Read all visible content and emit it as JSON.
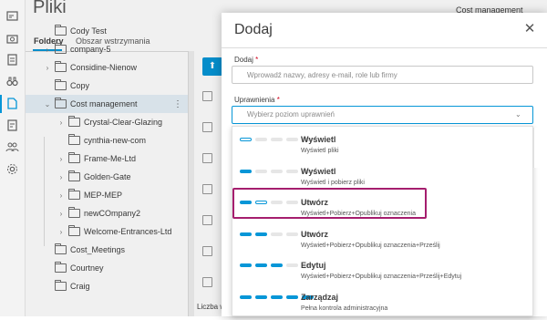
{
  "page": {
    "title": "Pliki",
    "tabs": [
      {
        "label": "Foldery",
        "active": true
      },
      {
        "label": "Obszar wstrzymania",
        "active": false
      }
    ],
    "right_item": "Cost management",
    "footer_text": "Liczba wyś"
  },
  "tree": [
    {
      "label": "Cody Test",
      "expandable": false,
      "level": 0
    },
    {
      "label": "company-5",
      "expandable": true,
      "level": 0
    },
    {
      "label": "Considine-Nienow",
      "expandable": true,
      "level": 0
    },
    {
      "label": "Copy",
      "expandable": false,
      "level": 0
    },
    {
      "label": "Cost management",
      "expandable": true,
      "expanded": true,
      "selected": true,
      "level": 0
    },
    {
      "label": "Crystal-Clear-Glazing",
      "expandable": true,
      "level": 1
    },
    {
      "label": "cynthia-new-com",
      "expandable": false,
      "level": 1
    },
    {
      "label": "Frame-Me-Ltd",
      "expandable": true,
      "level": 1
    },
    {
      "label": "Golden-Gate",
      "expandable": true,
      "level": 1
    },
    {
      "label": "MEP-MEP",
      "expandable": true,
      "level": 1
    },
    {
      "label": "newCOmpany2",
      "expandable": true,
      "level": 1
    },
    {
      "label": "Welcome-Entrances-Ltd",
      "expandable": true,
      "level": 1
    },
    {
      "label": "Cost_Meetings",
      "expandable": false,
      "level": 0
    },
    {
      "label": "Courtney",
      "expandable": false,
      "level": 0
    },
    {
      "label": "Craig",
      "expandable": false,
      "level": 0
    }
  ],
  "dialog": {
    "title": "Dodaj",
    "add_label": "Dodaj",
    "add_placeholder": "Wprowadź nazwy, adresy e-mail, role lub firmy",
    "perm_label": "Uprawnienia",
    "perm_placeholder": "Wybierz poziom uprawnień",
    "options": [
      {
        "title": "Wyświetl",
        "desc": "Wyświetl pliki",
        "bars": [
          "outline",
          "empty",
          "empty",
          "empty",
          "empty"
        ]
      },
      {
        "title": "Wyświetl",
        "desc": "Wyświetl i pobierz pliki",
        "bars": [
          "full",
          "empty",
          "empty",
          "empty",
          "empty"
        ]
      },
      {
        "title": "Utwórz",
        "desc": "Wyświetl+Pobierz+Opublikuj oznaczenia",
        "bars": [
          "full",
          "outline",
          "empty",
          "empty",
          "empty"
        ]
      },
      {
        "title": "Utwórz",
        "desc": "Wyświetl+Pobierz+Opublikuj oznaczenia+Prześlij",
        "bars": [
          "full",
          "full",
          "empty",
          "empty",
          "empty"
        ]
      },
      {
        "title": "Edytuj",
        "desc": "Wyświetl+Pobierz+Opublikuj oznaczenia+Prześlij+Edytuj",
        "bars": [
          "full",
          "full",
          "full",
          "empty",
          "empty"
        ]
      },
      {
        "title": "Zarządzaj",
        "desc": "Pełna kontrola administracyjna",
        "bars": [
          "full",
          "full",
          "full",
          "full",
          "full"
        ]
      }
    ],
    "highlighted_option": 2
  },
  "colors": {
    "accent": "#0696d7",
    "highlight": "#a51e6e",
    "required": "#d0021b"
  }
}
